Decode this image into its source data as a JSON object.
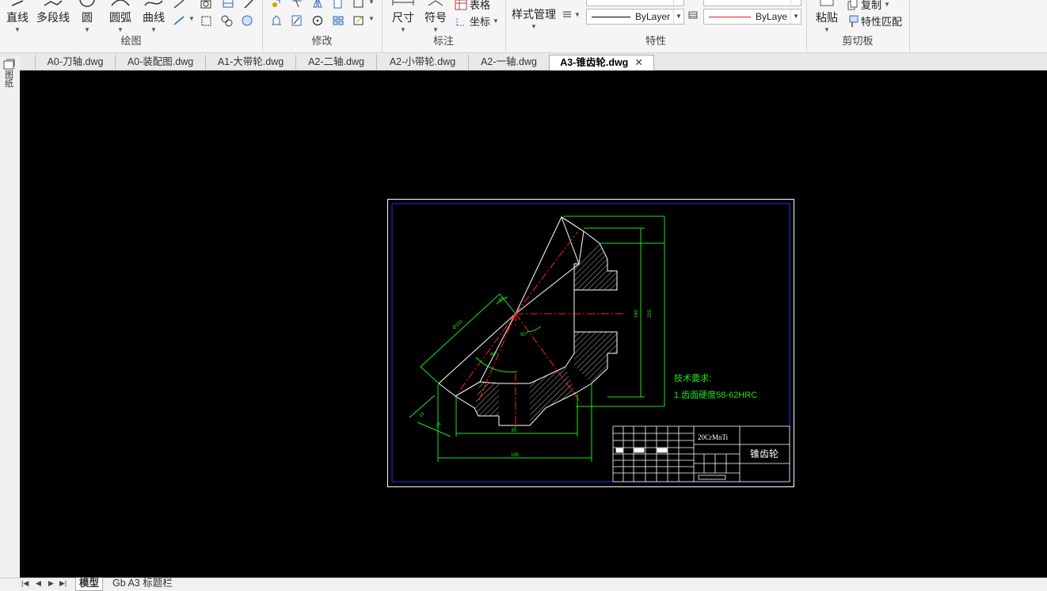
{
  "ribbon": {
    "draw": {
      "title": "绘图",
      "line": "直线",
      "polyline": "多段线",
      "circle": "圆",
      "arc": "圆弧",
      "curve": "曲线"
    },
    "modify": {
      "title": "修改"
    },
    "annotate": {
      "title": "标注",
      "dimension": "尺寸",
      "symbol": "符号",
      "table": "表格",
      "coordinate": "坐标"
    },
    "properties": {
      "title": "特性",
      "style_manager": "样式管理",
      "linetype_value": "ByLayer",
      "color_value": "ByLaye"
    },
    "clipboard": {
      "title": "剪切板",
      "paste": "粘贴",
      "copy": "复制",
      "match_properties": "特性匹配"
    }
  },
  "side_panel_label": "图纸",
  "tabs": [
    {
      "label": "A0-刀轴.dwg",
      "active": false
    },
    {
      "label": "A0-装配图.dwg",
      "active": false
    },
    {
      "label": "A1-大带轮.dwg",
      "active": false
    },
    {
      "label": "A2-二轴.dwg",
      "active": false
    },
    {
      "label": "A2-小带轮.dwg",
      "active": false
    },
    {
      "label": "A2-一轴.dwg",
      "active": false
    },
    {
      "label": "A3-锥齿轮.dwg",
      "active": true
    }
  ],
  "drawing": {
    "tech_req_title": "技术要求:",
    "tech_req_item": "1.齿面硬度58-62HRC",
    "material": "20CrMnTi",
    "part_name": "锥齿轮",
    "dim_bottom_inner": "85",
    "dim_bottom_outer": "185",
    "dim_right_inner": "160",
    "dim_right_outer": "220",
    "dim_slant": "Ø153",
    "dim_angle_small": "25",
    "dim_angle_a": "90°",
    "dim_angle_b": "46°",
    "dim_small_a": "10",
    "dim_small_b": "14"
  },
  "layouts": [
    {
      "label": "模型",
      "active": true
    },
    {
      "label": "Gb A3 标题栏",
      "active": false
    }
  ],
  "colors": {
    "canvas_bg": "#000000",
    "frame_white": "#ffffff",
    "frame_blue": "#0000ff",
    "dim_green": "#00ff00",
    "center_red": "#ff0000"
  }
}
